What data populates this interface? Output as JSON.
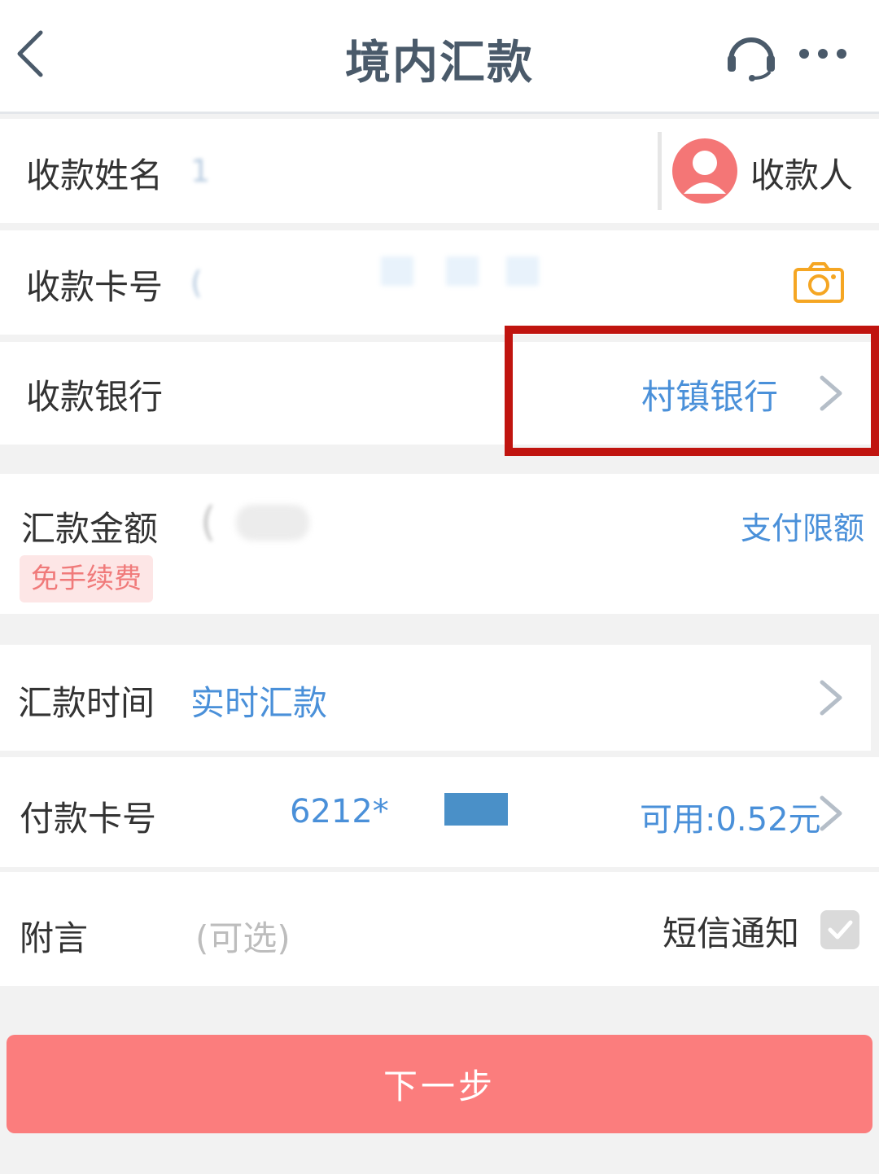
{
  "header": {
    "title": "境内汇款"
  },
  "form": {
    "payee_name": {
      "label": "收款姓名",
      "value": "1",
      "contact_button": "收款人"
    },
    "payee_card": {
      "label": "收款卡号",
      "value": "("
    },
    "payee_bank": {
      "label": "收款银行",
      "value": "村镇银行"
    },
    "amount": {
      "label": "汇款金额",
      "value": "(",
      "limit_link": "支付限额",
      "fee_badge": "免手续费"
    },
    "time": {
      "label": "汇款时间",
      "value": "实时汇款"
    },
    "pay_card": {
      "label": "付款卡号",
      "value": "6212*",
      "available": "可用:0.52元"
    },
    "memo": {
      "label": "附言",
      "placeholder": "(可选)",
      "sms_label": "短信通知",
      "sms_checked": true
    }
  },
  "actions": {
    "next_label": "下一步"
  },
  "colors": {
    "accent_blue": "#4a90d9",
    "primary_button": "#fb7d7d",
    "highlight_border": "#c0140f",
    "camera_orange": "#f5a623"
  }
}
